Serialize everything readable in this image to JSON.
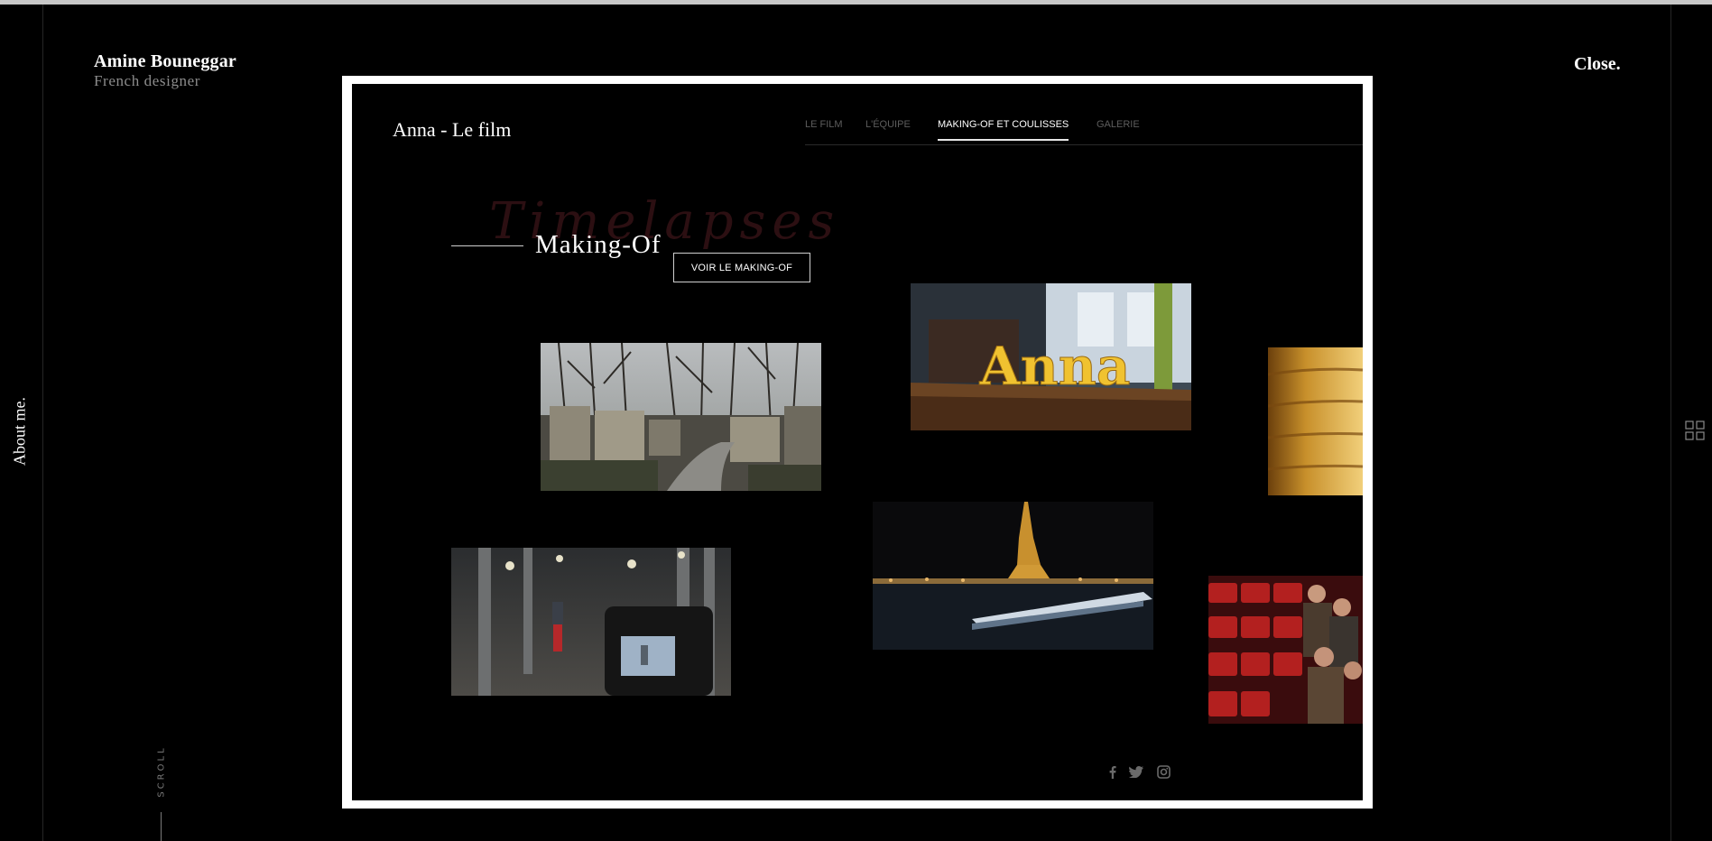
{
  "header": {
    "name": "Amine Bouneggar",
    "subtitle": "French designer",
    "close_label": "Close."
  },
  "side": {
    "about_label": "About me.",
    "scroll_label": "SCROLL",
    "grid_icon": "grid-icon"
  },
  "project": {
    "site_title": "Anna - Le film",
    "nav": [
      {
        "label": "LE FILM",
        "active": false
      },
      {
        "label": "L'ÉQUIPE",
        "active": false
      },
      {
        "label": "MAKING-OF ET COULISSES",
        "active": true
      },
      {
        "label": "GALERIE",
        "active": false
      }
    ],
    "background_word": "Timelapses",
    "section_title": "Making-Of",
    "cta_label": "VOIR LE MAKING-OF",
    "photo_text": "Anna",
    "social_icons": [
      "facebook-icon",
      "twitter-icon",
      "instagram-icon"
    ]
  },
  "colors": {
    "background": "#000000",
    "frame": "#ffffff",
    "muted_text": "#8d8d8d",
    "background_word": "#2c0f12"
  }
}
